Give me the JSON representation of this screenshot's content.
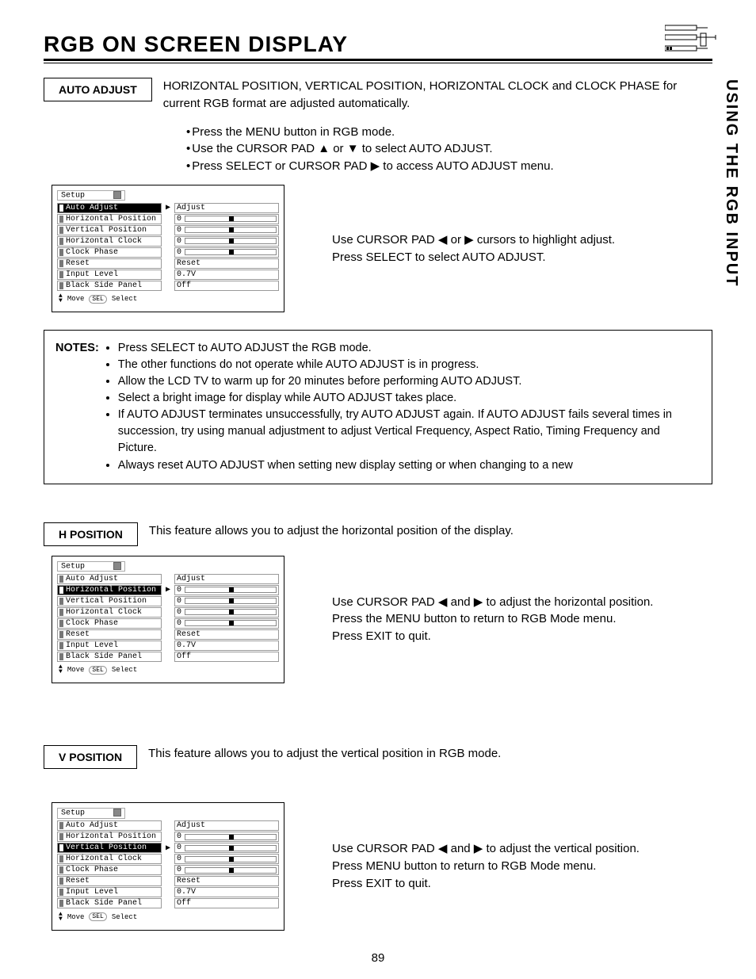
{
  "page_number": "89",
  "side_tab": "USING THE RGB INPUT",
  "title": "RGB ON SCREEN DISPLAY",
  "sections": {
    "auto_adjust": {
      "label": "AUTO ADJUST",
      "desc": "HORIZONTAL POSITION, VERTICAL POSITION, HORIZONTAL CLOCK and CLOCK PHASE for current RGB format are adjusted automatically.",
      "steps": [
        "Press the MENU button in RGB mode.",
        "Use the CURSOR PAD ▲ or ▼ to select AUTO ADJUST.",
        "Press SELECT or CURSOR PAD ▶ to access AUTO ADJUST menu."
      ],
      "help1": "Use CURSOR PAD ◀ or ▶ cursors to highlight adjust.",
      "help2": "Press SELECT to select AUTO ADJUST."
    },
    "h_position": {
      "label": "H POSITION",
      "desc": "This feature allows you to adjust the horizontal position of the display.",
      "help1": "Use CURSOR PAD ◀ and ▶ to adjust the horizontal position.",
      "help2": "Press the MENU button to return to RGB Mode menu.",
      "help3": "Press EXIT to quit."
    },
    "v_position": {
      "label": "V POSITION",
      "desc": "This feature allows you to adjust the vertical position in RGB mode.",
      "help1": "Use CURSOR PAD ◀ and ▶ to adjust the vertical position.",
      "help2": "Press MENU button to return to RGB Mode menu.",
      "help3": "Press EXIT to quit."
    }
  },
  "notes": {
    "lead": "NOTES:",
    "items": [
      "Press SELECT to AUTO ADJUST the RGB mode.",
      "The other functions do not operate while AUTO ADJUST is in progress.",
      "Allow the LCD TV to warm up for 20 minutes before performing AUTO ADJUST.",
      "Select a bright image for display while AUTO ADJUST takes place.",
      "If AUTO ADJUST terminates unsuccessfully, try AUTO ADJUST again.  If AUTO ADJUST fails several times in succession, try using manual adjustment to adjust Vertical Frequency, Aspect Ratio, Timing Frequency and Picture.",
      "Always reset AUTO ADJUST when setting new display setting or when changing to a new"
    ]
  },
  "osd": {
    "title": "Setup",
    "footer_move": "Move",
    "footer_select": "Select",
    "items": [
      {
        "label": "Auto Adjust",
        "right_type": "text",
        "right": "Adjust"
      },
      {
        "label": "Horizontal Position",
        "right_type": "bar",
        "right": "0"
      },
      {
        "label": "Vertical Position",
        "right_type": "bar",
        "right": "0"
      },
      {
        "label": "Horizontal Clock",
        "right_type": "bar",
        "right": "0"
      },
      {
        "label": "Clock Phase",
        "right_type": "bar",
        "right": "0"
      },
      {
        "label": "Reset",
        "right_type": "text",
        "right": "Reset"
      },
      {
        "label": "Input Level",
        "right_type": "text",
        "right": "0.7V"
      },
      {
        "label": "Black Side Panel",
        "right_type": "text",
        "right": "Off"
      }
    ],
    "selected_auto": 0,
    "selected_h": 1,
    "selected_v": 2
  }
}
